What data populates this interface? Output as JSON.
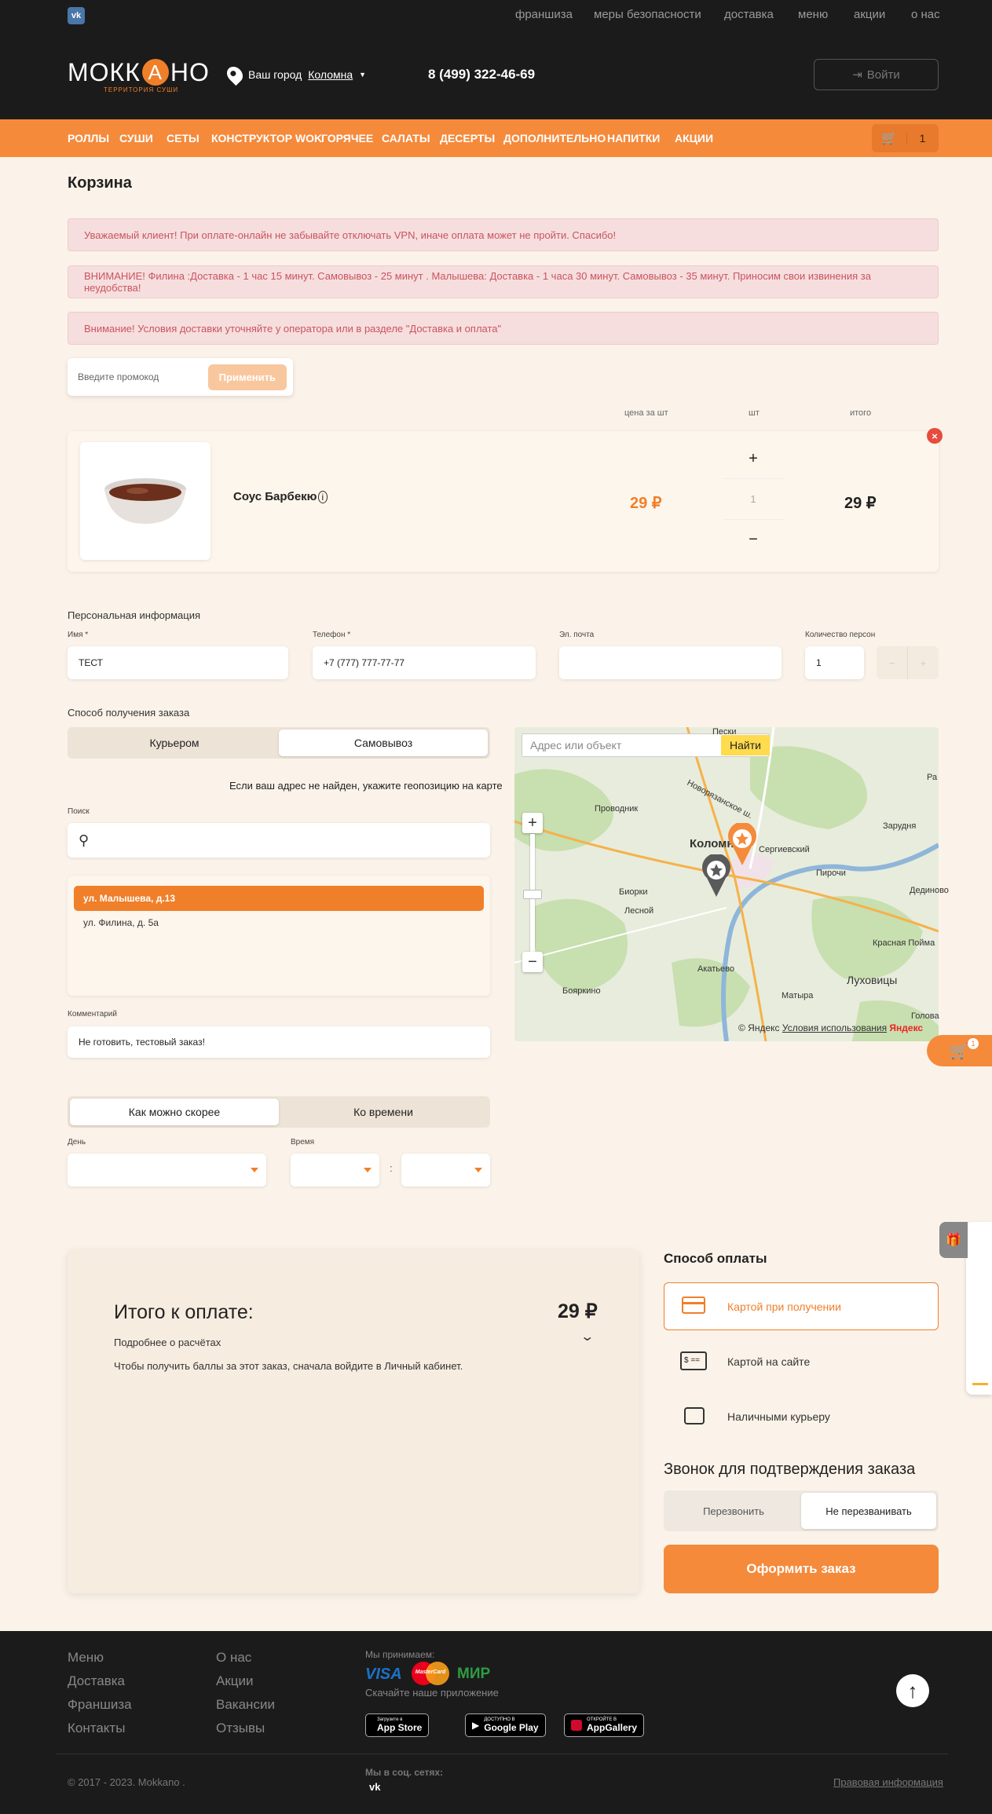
{
  "topbar": {
    "links": [
      "франшиза",
      "меры безопасности",
      "доставка",
      "меню",
      "акции",
      "о нас"
    ]
  },
  "header": {
    "logo": "МОККАНО",
    "logo_sub": "ТЕРРИТОРИЯ СУШИ",
    "city_label": "Ваш город",
    "city": "Коломна",
    "phone": "8 (499) 322-46-69",
    "login": "Войти"
  },
  "nav": {
    "items": [
      "РОЛЛЫ",
      "СУШИ",
      "СЕТЫ",
      "КОНСТРУКТОР WOK",
      "ГОРЯЧЕЕ",
      "САЛАТЫ",
      "ДЕСЕРТЫ",
      "ДОПОЛНИТЕЛЬНО",
      "НАПИТКИ",
      "АКЦИИ"
    ],
    "cart_count": "1"
  },
  "page_title": "Корзина",
  "alerts": [
    "Уважаемый клиент! При оплате-онлайн не забывайте отключать VPN, иначе оплата может не пройти. Спасибо!",
    "ВНИМАНИЕ! Филина :Доставка - 1 час 15 минут. Самовывоз - 25 минут . Малышева: Доставка - 1 часа 30 минут. Самовывоз - 35 минут. Приносим свои извинения за неудобства!",
    "Внимание! Условия доставки уточняйте у оператора или в разделе \"Доставка и оплата\""
  ],
  "promo": {
    "placeholder": "Введите промокод",
    "apply": "Применить"
  },
  "cart_table": {
    "col_price": "цена за шт",
    "col_qty": "шт",
    "col_total": "итого"
  },
  "item": {
    "name": "Соус Барбекю",
    "price": "29 ₽",
    "qty": "1",
    "total": "29 ₽",
    "plus": "+",
    "minus": "−"
  },
  "personal": {
    "title": "Персональная информация",
    "name_label": "Имя *",
    "name": "ТЕСТ",
    "phone_label": "Телефон *",
    "phone": "+7 (777) 777-77-77",
    "email_label": "Эл. почта",
    "persons_label": "Количество персон",
    "persons": "1"
  },
  "delivery": {
    "title": "Способ получения заказа",
    "courier": "Курьером",
    "pickup": "Самовывоз",
    "hint": "Если ваш адрес не найден, укажите геопозицию на карте",
    "search_label": "Поиск",
    "addresses": [
      "ул. Малышева, д.13",
      "ул. Филина, д. 5а"
    ],
    "comment_label": "Комментарий",
    "comment": "Не готовить, тестовый заказ!"
  },
  "map": {
    "search_placeholder": "Адрес или объект",
    "find": "Найти",
    "places": [
      "Пески",
      "Проводник",
      "Новорязанское ш.",
      "Коломна",
      "Сергиевский",
      "Зарудня",
      "Биорки",
      "Лесной",
      "Пирочи",
      "Акатьево",
      "Бояркино",
      "Красная Пойма",
      "Луховицы",
      "Матыра",
      "Дединово",
      "Ра",
      "Голова"
    ],
    "attribution": "© Яндекс",
    "terms": "Условия использования",
    "brand": "Яндекс"
  },
  "time": {
    "asap": "Как можно скорее",
    "by_time": "Ко времени",
    "day_label": "День",
    "time_label": "Время",
    "colon": ":"
  },
  "summary": {
    "title": "Итого к оплате:",
    "amount": "29 ₽",
    "details": "Подробнее о расчётах",
    "points_note": "Чтобы получить баллы за этот заказ, сначала войдите в Личный кабинет."
  },
  "payment": {
    "title": "Способ оплаты",
    "methods": [
      "Картой при получении",
      "Картой на сайте",
      "Наличными курьеру"
    ]
  },
  "callback": {
    "title": "Звонок для подтверждения заказа",
    "call": "Перезвонить",
    "no_call": "Не перезванивать"
  },
  "place_order": "Оформить заказ",
  "sidebadge": "1",
  "footer": {
    "col1": [
      "Меню",
      "Доставка",
      "Франшиза",
      "Контакты"
    ],
    "col2": [
      "О нас",
      "Акции",
      "Вакансии",
      "Отзывы"
    ],
    "we_accept": "Мы принимаем:",
    "cards": [
      "VISA",
      "MasterCard",
      "МИР"
    ],
    "download": "Скачайте наше приложение",
    "stores": [
      {
        "small": "Загрузите в",
        "name": "App Store"
      },
      {
        "small": "ДОСТУПНО В",
        "name": "Google Play"
      },
      {
        "small": "ОТКРОЙТЕ В",
        "name": "AppGallery"
      }
    ],
    "social": "Мы в соц. сетях:",
    "copyright": "© 2017 - 2023. Mokkano .",
    "legal": "Правовая информация"
  },
  "colors": {
    "accent": "#f58a3b",
    "dark": "#1b1b1b",
    "bg": "#fbf3e9"
  }
}
